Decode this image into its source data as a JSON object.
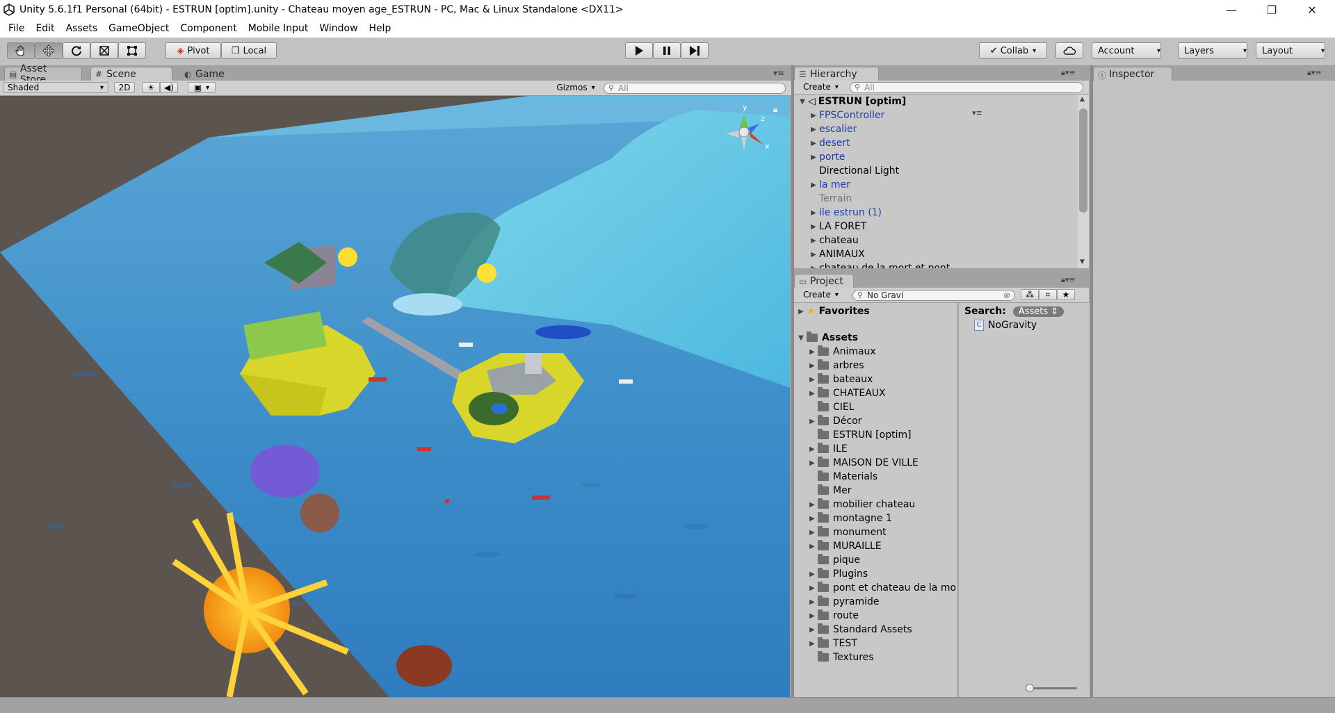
{
  "window": {
    "title": "Unity 5.6.1f1 Personal (64bit) - ESTRUN [optim].unity - Chateau moyen age_ESTRUN - PC, Mac & Linux Standalone <DX11>",
    "minimize_icon": "minimize-icon",
    "maximize_icon": "restore-icon",
    "close_icon": "close-icon"
  },
  "menu": [
    "File",
    "Edit",
    "Assets",
    "GameObject",
    "Component",
    "Mobile Input",
    "Window",
    "Help"
  ],
  "toolbar": {
    "tools": [
      "hand-tool-icon",
      "move-tool-icon",
      "rotate-tool-icon",
      "scale-tool-icon",
      "rect-tool-icon"
    ],
    "pivot_label": "Pivot",
    "local_label": "Local",
    "play_icon": "play-icon",
    "pause_icon": "pause-icon",
    "step_icon": "step-icon",
    "collab_label": "Collab",
    "cloud_icon": "cloud-icon",
    "account_label": "Account",
    "layers_label": "Layers",
    "layout_label": "Layout"
  },
  "scene_panel": {
    "tabs": [
      "Asset Store",
      "Scene",
      "Game"
    ],
    "active_tab": "Scene",
    "shading_mode": "Shaded",
    "mode_2d": "2D",
    "gizmos_label": "Gizmos",
    "search_placeholder": "All",
    "axis_labels": {
      "y": "y",
      "z": "z",
      "x": "x"
    }
  },
  "hierarchy": {
    "tab_label": "Hierarchy",
    "create_label": "Create",
    "search_placeholder": "All",
    "scene_name": "ESTRUN [optim]",
    "items": [
      {
        "label": "FPSController",
        "expandable": true,
        "style": "prefab"
      },
      {
        "label": "escalier",
        "expandable": true,
        "style": "prefab"
      },
      {
        "label": "desert",
        "expandable": true,
        "style": "prefab"
      },
      {
        "label": "porte",
        "expandable": true,
        "style": "prefab"
      },
      {
        "label": "Directional Light",
        "expandable": false,
        "style": "normal"
      },
      {
        "label": "la mer",
        "expandable": true,
        "style": "prefab"
      },
      {
        "label": "Terrain",
        "expandable": false,
        "style": "inactive"
      },
      {
        "label": "ile estrun (1)",
        "expandable": true,
        "style": "prefab"
      },
      {
        "label": "LA FORET",
        "expandable": true,
        "style": "normal"
      },
      {
        "label": "chateau",
        "expandable": true,
        "style": "normal"
      },
      {
        "label": "ANIMAUX",
        "expandable": true,
        "style": "normal"
      },
      {
        "label": "chateau de la mort et pont",
        "expandable": true,
        "style": "normal"
      }
    ]
  },
  "project": {
    "tab_label": "Project",
    "create_label": "Create",
    "search_value": "No Gravi",
    "favorites_label": "Favorites",
    "assets_label": "Assets",
    "folders": [
      {
        "label": "Animaux",
        "expandable": true
      },
      {
        "label": "arbres",
        "expandable": true
      },
      {
        "label": "bateaux",
        "expandable": true
      },
      {
        "label": "CHATEAUX",
        "expandable": true
      },
      {
        "label": "CIEL",
        "expandable": false
      },
      {
        "label": "Décor",
        "expandable": true
      },
      {
        "label": "ESTRUN [optim]",
        "expandable": false
      },
      {
        "label": "ILE",
        "expandable": true
      },
      {
        "label": "MAISON DE VILLE",
        "expandable": true
      },
      {
        "label": "Materials",
        "expandable": false
      },
      {
        "label": "Mer",
        "expandable": false
      },
      {
        "label": "mobilier chateau",
        "expandable": true
      },
      {
        "label": "montagne 1",
        "expandable": true
      },
      {
        "label": "monument",
        "expandable": true
      },
      {
        "label": "MURAILLE",
        "expandable": true
      },
      {
        "label": "pique",
        "expandable": false
      },
      {
        "label": "Plugins",
        "expandable": true
      },
      {
        "label": "pont et chateau de la mo",
        "expandable": true
      },
      {
        "label": "pyramide",
        "expandable": true
      },
      {
        "label": "route",
        "expandable": true
      },
      {
        "label": "Standard Assets",
        "expandable": true
      },
      {
        "label": "TEST",
        "expandable": true
      },
      {
        "label": "Textures",
        "expandable": false
      }
    ],
    "search_label": "Search:",
    "search_scope": "Assets",
    "results": [
      "NoGravity"
    ]
  },
  "inspector": {
    "tab_label": "Inspector"
  }
}
